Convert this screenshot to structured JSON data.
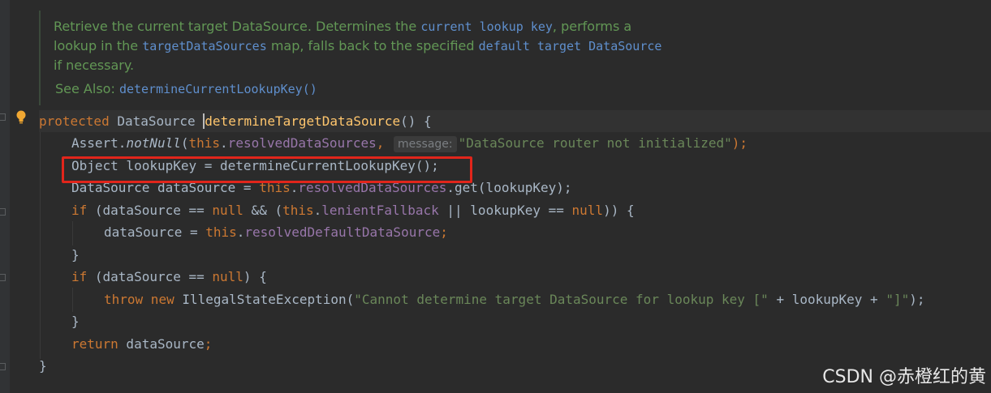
{
  "doc_comment": {
    "text_1": "Retrieve the current target DataSource. Determines the ",
    "code_1": "current lookup key",
    "text_2": ", performs a lookup in the ",
    "code_2": "targetDataSources",
    "text_3": " map, falls back to the specified ",
    "code_3": "default target DataSource",
    "text_4": " if necessary.",
    "see_also_label": "See Also:",
    "see_also_link": "determineCurrentLookupKey()"
  },
  "code": {
    "l1_kw": "protected",
    "l1_type": " DataSource ",
    "l1_method": "determineTargetDataSource",
    "l1_rest": "() {",
    "l2_a": "Assert.",
    "l2_fn": "notNull",
    "l2_b": "(",
    "l2_this": "this",
    "l2_c": ".",
    "l2_field": "resolvedDataSources",
    "l2_d": ",",
    "l2_hint": "message:",
    "l2_str": "\"DataSource router not initialized\"",
    "l2_e": ");",
    "l3": "Object lookupKey = determineCurrentLookupKey();",
    "l4_a": "DataSource dataSource = ",
    "l4_this": "this",
    "l4_b": ".",
    "l4_field": "resolvedDataSources",
    "l4_c": ".get(lookupKey);",
    "l5_if": "if",
    "l5_a": " (dataSource == ",
    "l5_null": "null",
    "l5_b": " && (",
    "l5_this": "this",
    "l5_c": ".",
    "l5_field": "lenientFallback",
    "l5_d": " || lookupKey == ",
    "l5_null2": "null",
    "l5_e": ")) {",
    "l6_a": "dataSource = ",
    "l6_this": "this",
    "l6_b": ".",
    "l6_field": "resolvedDefaultDataSource",
    "l6_c": ";",
    "l7": "}",
    "l8_if": "if",
    "l8_a": " (dataSource == ",
    "l8_null": "null",
    "l8_b": ") {",
    "l9_throw": "throw",
    "l9_new": " new",
    "l9_a": " IllegalStateException(",
    "l9_str": "\"Cannot determine target DataSource for lookup key [\"",
    "l9_b": " + lookupKey + ",
    "l9_str2": "\"]\"",
    "l9_c": ");",
    "l10": "}",
    "l11_ret": "return",
    "l11_a": " dataSource",
    "l11_b": ";",
    "l12": "}"
  },
  "watermark": "CSDN @赤橙红的黄",
  "colors": {
    "background": "#2b2b2b",
    "keyword": "#cc7832",
    "method": "#ffc66d",
    "field": "#9876aa",
    "string": "#6a8759",
    "doc": "#629755",
    "highlight_box": "#e1251b"
  }
}
